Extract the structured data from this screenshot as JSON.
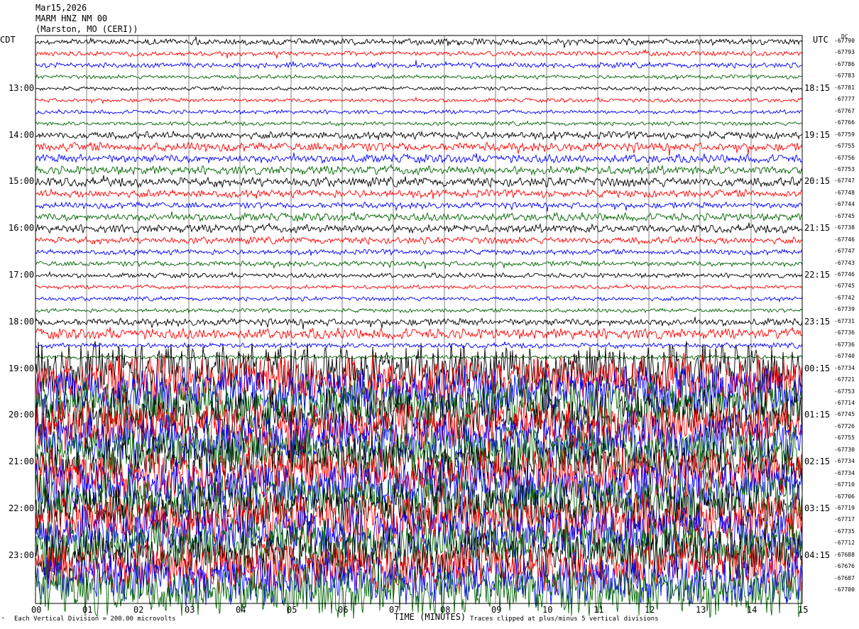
{
  "header": {
    "date": "Mar15,2026",
    "station": "MARM HNZ NM 00",
    "location": "(Marston, MO (CERI))"
  },
  "left_tz": "CDT",
  "right_tz": "UTC",
  "dc_label": "DC",
  "footer": {
    "scale_note": "Each Vertical Division = 200.00 microvolts",
    "clip_note": "Traces clipped at plus/minus 5 vertical divisions",
    "corner_mark": "^"
  },
  "colors": {
    "black": "#000000",
    "red": "#ff0000",
    "blue": "#0000ff",
    "green": "#006400",
    "grid": "#808080"
  },
  "chart_data": {
    "type": "helicorder",
    "title": "MARM HNZ NM 00",
    "xlabel": "TIME (MINUTES)",
    "x_ticks": [
      "00",
      "01",
      "02",
      "03",
      "04",
      "05",
      "06",
      "07",
      "08",
      "09",
      "10",
      "11",
      "12",
      "13",
      "14",
      "15"
    ],
    "x_range": [
      0,
      15
    ],
    "left_hour_labels": [
      "13:00",
      "14:00",
      "15:00",
      "16:00",
      "17:00",
      "18:00",
      "19:00",
      "20:00",
      "21:00",
      "22:00",
      "23:00"
    ],
    "right_hour_labels": [
      "18:15",
      "19:15",
      "20:15",
      "21:15",
      "22:15",
      "23:15",
      "00:15",
      "01:15",
      "02:15",
      "03:15",
      "04:15"
    ],
    "trace_color_cycle": [
      "black",
      "red",
      "blue",
      "green"
    ],
    "dc_offsets": [
      "-67790",
      "-67793",
      "-67786",
      "-67783",
      "-67781",
      "-67777",
      "-67767",
      "-67766",
      "-67759",
      "-67755",
      "-67756",
      "-67753",
      "-67747",
      "-67748",
      "-67744",
      "-67745",
      "-67738",
      "-67746",
      "-67747",
      "-67743",
      "-67746",
      "-67745",
      "-67742",
      "-67739",
      "-67731",
      "-67736",
      "-67736",
      "-67740",
      "-67734",
      "-67721",
      "-67753",
      "-67714",
      "-67745",
      "-67726",
      "-67755",
      "-67730",
      "-67734",
      "-67734",
      "-67710",
      "-67706",
      "-67719",
      "-67717",
      "-67735",
      "-67712",
      "-67688",
      "-67676",
      "-67687",
      "-67700"
    ],
    "relative_amplitude": [
      0.12,
      0.09,
      0.1,
      0.07,
      0.06,
      0.06,
      0.07,
      0.06,
      0.14,
      0.17,
      0.16,
      0.17,
      0.18,
      0.15,
      0.12,
      0.15,
      0.16,
      0.13,
      0.1,
      0.1,
      0.09,
      0.07,
      0.08,
      0.07,
      0.14,
      0.2,
      0.1,
      0.08,
      1.0,
      1.0,
      1.0,
      1.0,
      1.0,
      1.0,
      1.0,
      1.0,
      1.0,
      1.0,
      1.0,
      1.0,
      1.0,
      1.0,
      1.0,
      1.0,
      1.0,
      1.0,
      1.0,
      1.0
    ]
  }
}
